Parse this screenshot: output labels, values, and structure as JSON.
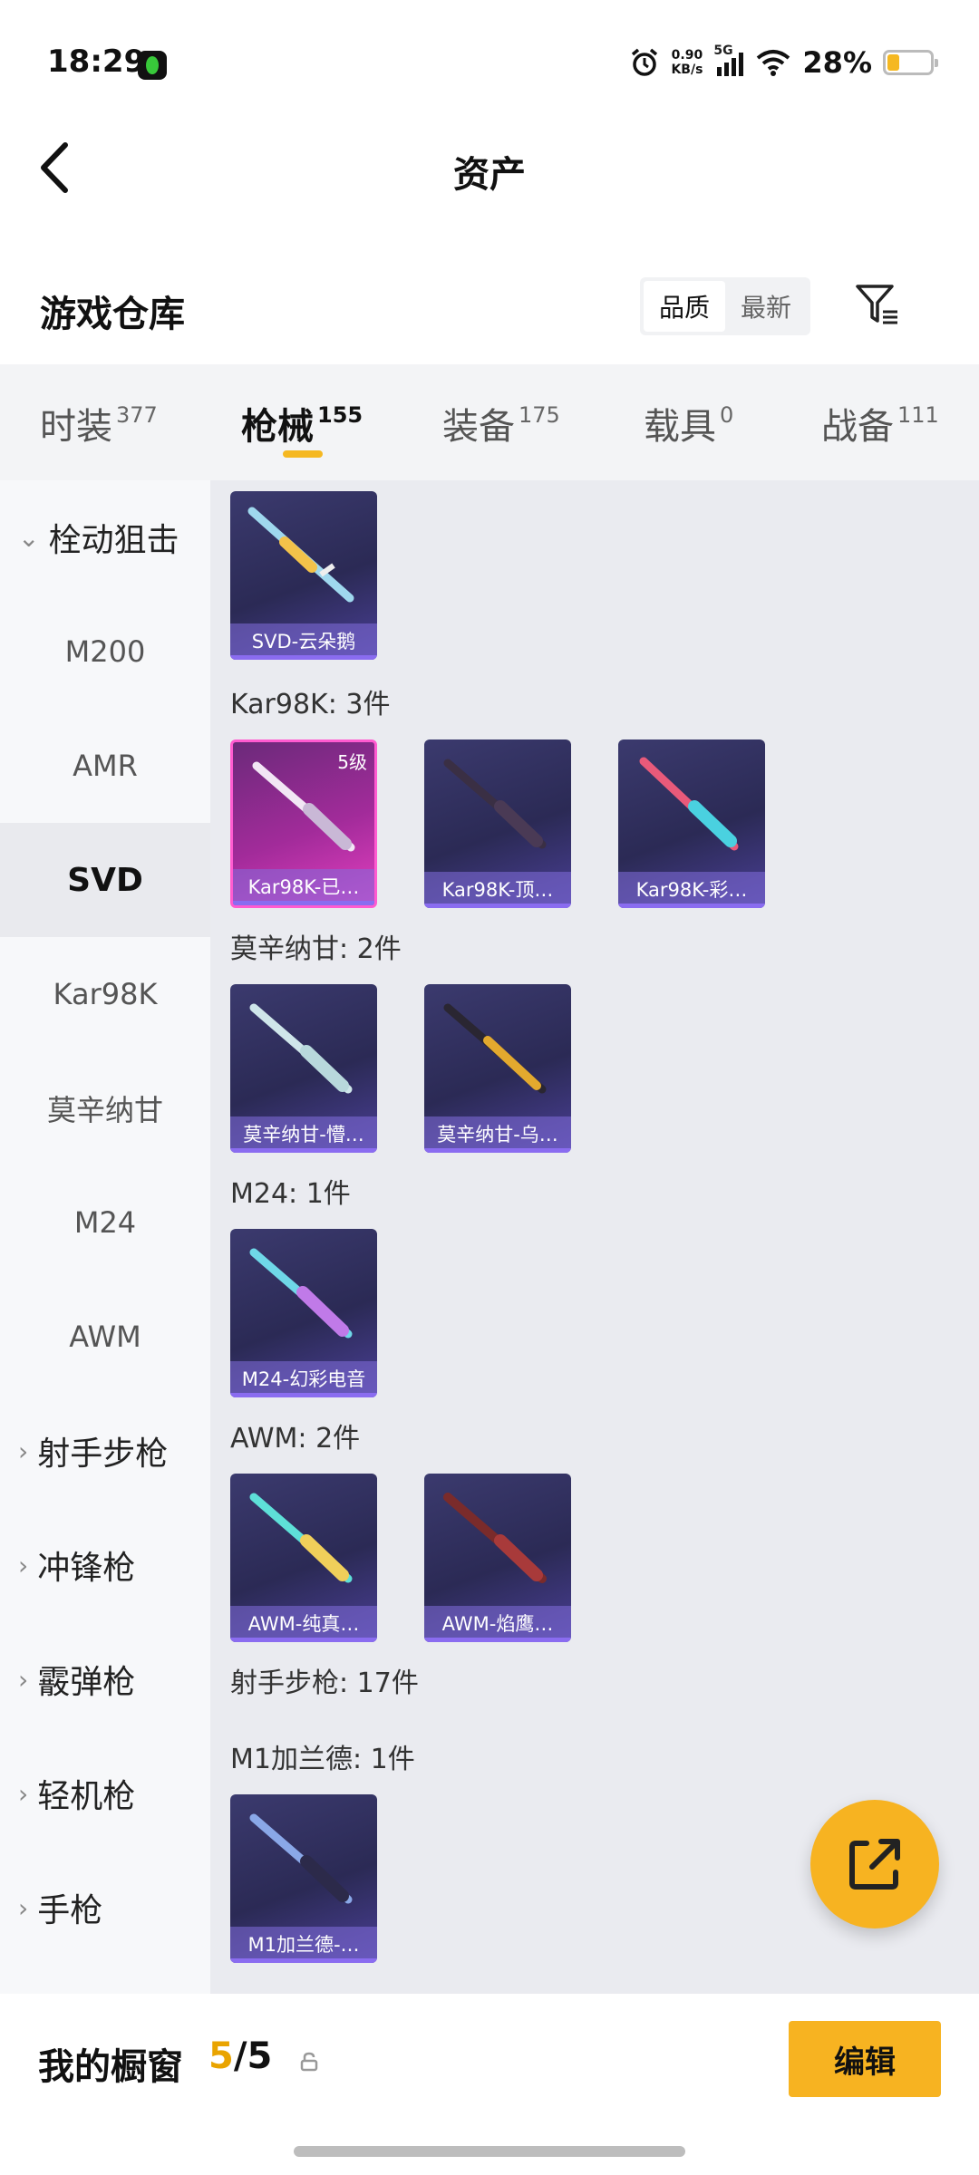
{
  "status": {
    "time": "18:29",
    "net_speed_value": "0.90",
    "net_speed_unit": "KB/s",
    "network": "5G",
    "battery": "28%",
    "battery_color": "#f5b821"
  },
  "header": {
    "title": "资产",
    "back_icon": "chevron-left-icon"
  },
  "warehouse": {
    "title": "游戏仓库",
    "sort_options": [
      "品质",
      "最新"
    ],
    "sort_selected": "品质",
    "filter_icon": "filter-icon"
  },
  "tabs": [
    {
      "label": "时装",
      "count": "377"
    },
    {
      "label": "枪械",
      "count": "155",
      "active": true
    },
    {
      "label": "装备",
      "count": "175"
    },
    {
      "label": "载具",
      "count": "0"
    },
    {
      "label": "战备",
      "count": "111"
    }
  ],
  "sidebar": {
    "items": [
      {
        "label": "栓动狙击",
        "type": "group-expanded"
      },
      {
        "label": "M200"
      },
      {
        "label": "AMR"
      },
      {
        "label": "SVD",
        "selected": true
      },
      {
        "label": "Kar98K"
      },
      {
        "label": "莫辛纳甘"
      },
      {
        "label": "M24"
      },
      {
        "label": "AWM"
      },
      {
        "label": "射手步枪",
        "type": "group-collapsed"
      },
      {
        "label": "冲锋枪",
        "type": "group-collapsed"
      },
      {
        "label": "霰弹枪",
        "type": "group-collapsed"
      },
      {
        "label": "轻机枪",
        "type": "group-collapsed"
      },
      {
        "label": "手枪",
        "type": "group-collapsed"
      }
    ]
  },
  "content": {
    "groups": [
      {
        "label": "",
        "items": [
          {
            "name": "SVD-云朵鹅"
          }
        ]
      },
      {
        "label": "Kar98K: 3件",
        "items": [
          {
            "name": "Kar98K-已…",
            "badge": "5级",
            "rarity": "pink"
          },
          {
            "name": "Kar98K-顶…"
          },
          {
            "name": "Kar98K-彩…"
          }
        ]
      },
      {
        "label": "莫辛纳甘: 2件",
        "items": [
          {
            "name": "莫辛纳甘-懵…"
          },
          {
            "name": "莫辛纳甘-乌…"
          }
        ]
      },
      {
        "label": "M24: 1件",
        "items": [
          {
            "name": "M24-幻彩电音"
          }
        ]
      },
      {
        "label": "AWM: 2件",
        "items": [
          {
            "name": "AWM-纯真…"
          },
          {
            "name": "AWM-焰鹰…"
          }
        ]
      },
      {
        "label": "射手步枪: 17件",
        "items": []
      },
      {
        "label": "M1加兰德: 1件",
        "items": [
          {
            "name": "M1加兰德-…"
          }
        ]
      }
    ]
  },
  "fab": {
    "icon": "share-icon",
    "color": "#f7b321"
  },
  "bottom": {
    "showcase_label": "我的橱窗",
    "showcase_current": "5",
    "showcase_total": "/5",
    "edit_label": "编辑",
    "accent": "#f7b321"
  }
}
